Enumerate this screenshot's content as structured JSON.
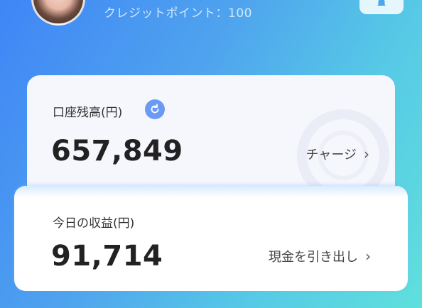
{
  "header": {
    "credit_points": "クレジットポイント：100"
  },
  "balance_card": {
    "label": "口座残高(円)",
    "amount": "657,849",
    "action_label": "チャージ"
  },
  "earnings_card": {
    "label": "今日の収益(円)",
    "amount": "91,714",
    "action_label": "現金を引き出し"
  },
  "icons": {
    "avatar": "avatar",
    "notification": "bell-icon",
    "refresh": "refresh-icon",
    "chevron": "chevron-right-icon"
  },
  "colors": {
    "accent": "#6b9af5",
    "gradient_start": "#3f86f6",
    "gradient_end": "#5fe0dc"
  }
}
